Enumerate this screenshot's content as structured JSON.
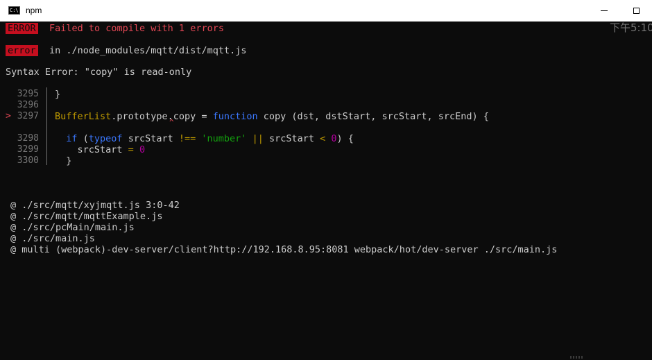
{
  "window": {
    "title": "npm",
    "icon_label": "C:\\",
    "icon": "console-icon",
    "minimize_icon": "minimize-icon",
    "maximize_icon": "maximize-icon"
  },
  "overlay_clock": "下午5:10",
  "header": {
    "badge": "ERROR",
    "message": "Failed to compile with 1 errors"
  },
  "error_line": {
    "badge": "error",
    "location": "in ./node_modules/mqtt/dist/mqtt.js"
  },
  "syntax_error": "Syntax Error: \"copy\" is read-only",
  "code": {
    "marker": ">",
    "lines": [
      {
        "num": "3295",
        "text": "}"
      },
      {
        "num": "3296",
        "text": ""
      },
      {
        "num": "3297",
        "tokens": [
          "BufferList",
          ".",
          "prototype",
          ".",
          "copy",
          " = ",
          "function",
          " copy (dst, dstStart, srcStart, srcEnd) {"
        ]
      },
      {
        "num": "3298",
        "tokens": [
          "  ",
          "if",
          " (",
          "typeof",
          " srcStart ",
          "!==",
          " ",
          "'number'",
          " ",
          "||",
          " srcStart ",
          "<",
          " ",
          "0",
          ") {"
        ]
      },
      {
        "num": "3299",
        "tokens": [
          "    srcStart ",
          "=",
          " ",
          "0"
        ]
      },
      {
        "num": "3300",
        "text": "  }"
      }
    ],
    "caret": "^"
  },
  "import_trace": [
    "@ ./src/mqtt/xyjmqtt.js 3:0-42",
    "@ ./src/mqtt/mqttExample.js",
    "@ ./src/pcMain/main.js",
    "@ ./src/main.js",
    "@ multi (webpack)-dev-server/client?http://192.168.8.95:8081 webpack/hot/dev-server ./src/main.js"
  ],
  "colors": {
    "background": "#0c0c0c",
    "error_red": "#c50f1f",
    "text": "#cccccc",
    "keyword_blue": "#3b78ff",
    "string_green": "#13a10e",
    "number_magenta": "#b4009e",
    "ident_yellow": "#c19c00"
  }
}
